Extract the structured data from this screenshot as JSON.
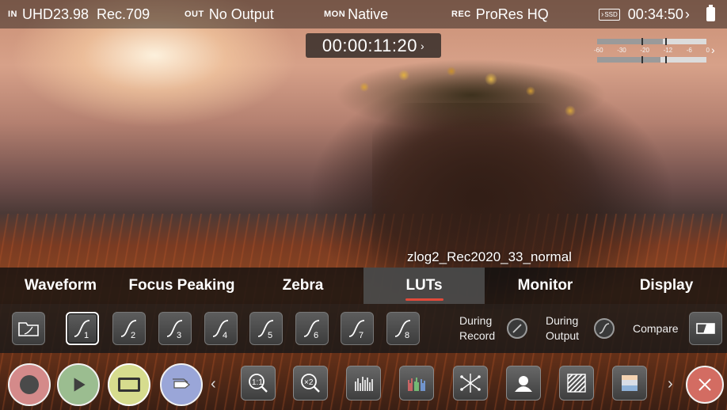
{
  "status": {
    "in_tag": "IN",
    "in_format": "UHD23.98",
    "colorspace": "Rec.709",
    "out_tag": "OUT",
    "out_value": "No Output",
    "mon_tag": "MON",
    "mon_value": "Native",
    "rec_tag": "REC",
    "rec_codec": "ProRes HQ",
    "media_icon_text": "SSD",
    "remaining": "00:34:50"
  },
  "timecode": "00:00:11:20",
  "meters": {
    "scale": [
      "-60",
      "-30",
      "-20",
      "-12",
      "-6",
      "0"
    ],
    "ch1_level": 0.6,
    "ch2_level": 0.58
  },
  "lut_file": "zlog2_Rec2020_33_normal",
  "tabs": [
    {
      "label": "Waveform",
      "active": false
    },
    {
      "label": "Focus Peaking",
      "active": false
    },
    {
      "label": "Zebra",
      "active": false
    },
    {
      "label": "LUTs",
      "active": true
    },
    {
      "label": "Monitor",
      "active": false
    },
    {
      "label": "Display",
      "active": false
    }
  ],
  "lut_slots": [
    "1",
    "2",
    "3",
    "4",
    "5",
    "6",
    "7",
    "8"
  ],
  "lut_selected": "1",
  "options": {
    "during_record": "During\nRecord",
    "during_record_l1": "During",
    "during_record_l2": "Record",
    "during_output_l1": "During",
    "during_output_l2": "Output",
    "compare": "Compare"
  },
  "colors": {
    "accent": "#e24a3a",
    "record_btn": "#d48a8a",
    "play_btn": "#9bbd90",
    "monitor_btn": "#d6dc8e",
    "tag_btn": "#9aa6d8",
    "close_btn": "#d36c62"
  }
}
